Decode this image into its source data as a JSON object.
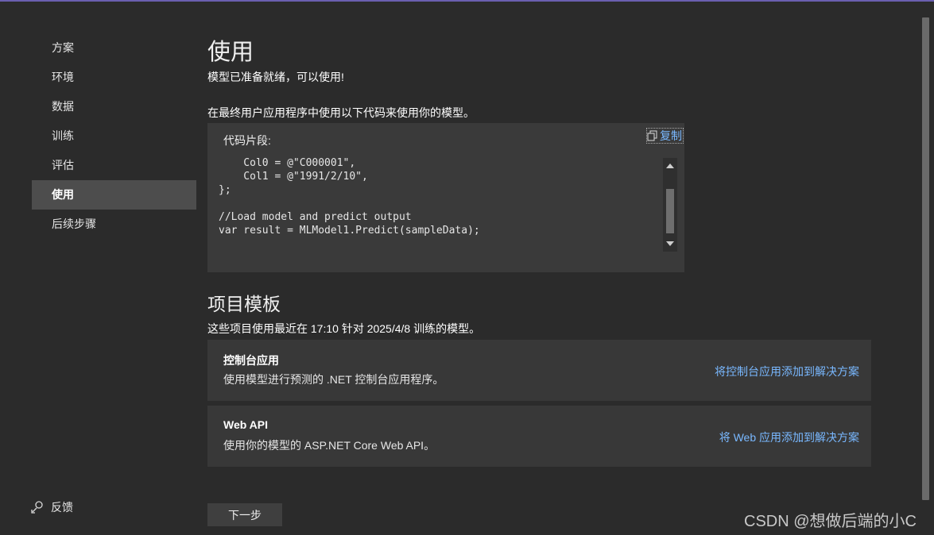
{
  "sidebar": {
    "items": [
      {
        "label": "方案"
      },
      {
        "label": "环境"
      },
      {
        "label": "数据"
      },
      {
        "label": "训练"
      },
      {
        "label": "评估"
      },
      {
        "label": "使用",
        "active": true
      },
      {
        "label": "后续步骤"
      }
    ],
    "feedback_label": "反馈"
  },
  "main": {
    "title": "使用",
    "ready_text": "模型已准备就绪，可以使用!",
    "instruction": "在最终用户应用程序中使用以下代码来使用你的模型。",
    "code_panel": {
      "label": "代码片段:",
      "copy_label": "复制",
      "code": "    Col0 = @\"C000001\",\n    Col1 = @\"1991/2/10\",\n};\n\n//Load model and predict output\nvar result = MLModel1.Predict(sampleData);",
      "scroll_position": 0.85
    },
    "templates": {
      "title": "项目模板",
      "subtitle": "这些项目使用最近在 17:10 针对 2025/4/8 训练的模型。",
      "cards": [
        {
          "title": "控制台应用",
          "description": "使用模型进行预测的 .NET 控制台应用程序。",
          "link": "将控制台应用添加到解决方案"
        },
        {
          "title": "Web API",
          "description": "使用你的模型的 ASP.NET Core Web API。",
          "link": "将 Web 应用添加到解决方案"
        }
      ]
    },
    "next_button": "下一步"
  },
  "watermark": "CSDN @想做后端的小C",
  "colors": {
    "background": "#2b2b2b",
    "link": "#79b8ff",
    "active_nav": "#4d4d4d",
    "panel": "#3a3a3a",
    "accent_line": "#6b5fb0"
  }
}
